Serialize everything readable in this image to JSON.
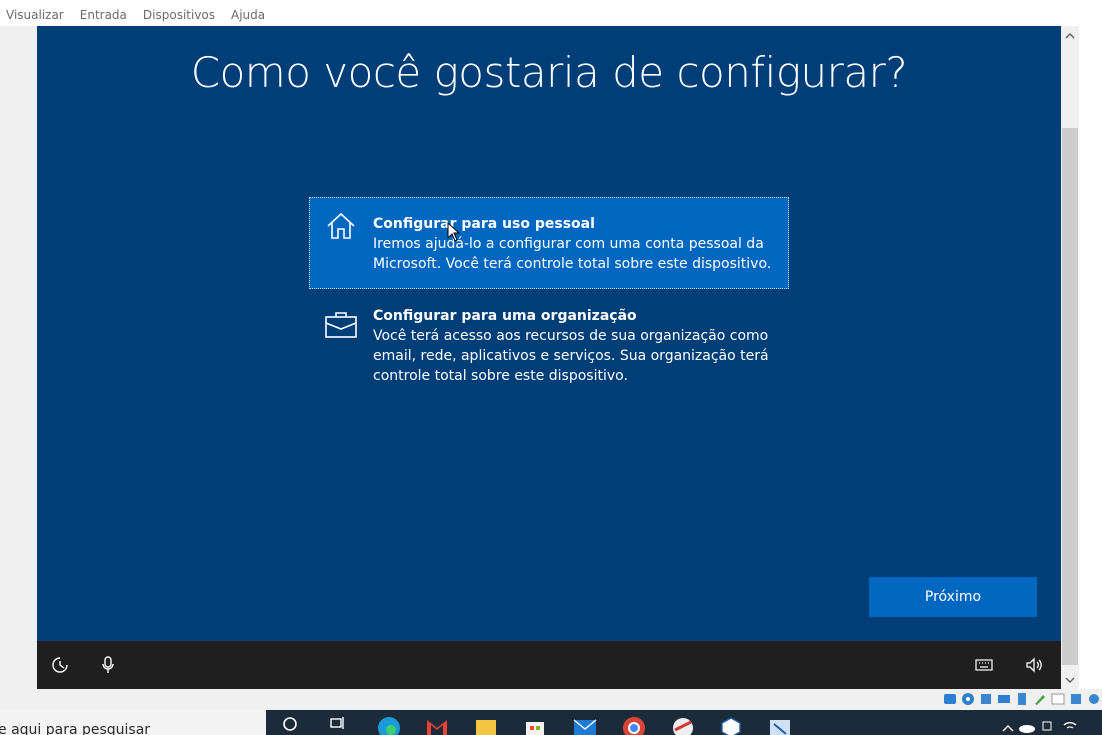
{
  "menubar": {
    "items": [
      "Visualizar",
      "Entrada",
      "Dispositivos",
      "Ajuda"
    ]
  },
  "oobe": {
    "title": "Como você gostaria de configurar?",
    "options": [
      {
        "title": "Configurar para uso pessoal",
        "description": "Iremos ajudá-lo a configurar com uma conta pessoal da Microsoft. Você terá controle total sobre este dispositivo.",
        "icon": "home-icon",
        "selected": true
      },
      {
        "title": "Configurar para uma organização",
        "description": "Você terá acesso aos recursos de sua organização como email, rede, aplicativos e serviços. Sua organização terá controle total sobre este dispositivo.",
        "icon": "briefcase-icon",
        "selected": false
      }
    ],
    "next_label": "Próximo"
  },
  "guest_bottombar": {
    "left_icons": [
      "accessibility-icon",
      "microphone-icon"
    ],
    "right_icons": [
      "keyboard-icon",
      "volume-icon"
    ]
  },
  "host_taskbar": {
    "search_placeholder": "e aqui para pesquisar",
    "apps": [
      "search-icon",
      "task-view-icon",
      "edge-icon",
      "gmail-icon",
      "file-explorer-icon",
      "store-icon",
      "mail-icon",
      "chrome-icon",
      "app-icon",
      "virtualbox-icon",
      "settings-app-icon"
    ]
  },
  "colors": {
    "oobe_background": "#003e78",
    "accent_blue": "#0067c0",
    "bottom_bar": "#1f1f1f"
  }
}
